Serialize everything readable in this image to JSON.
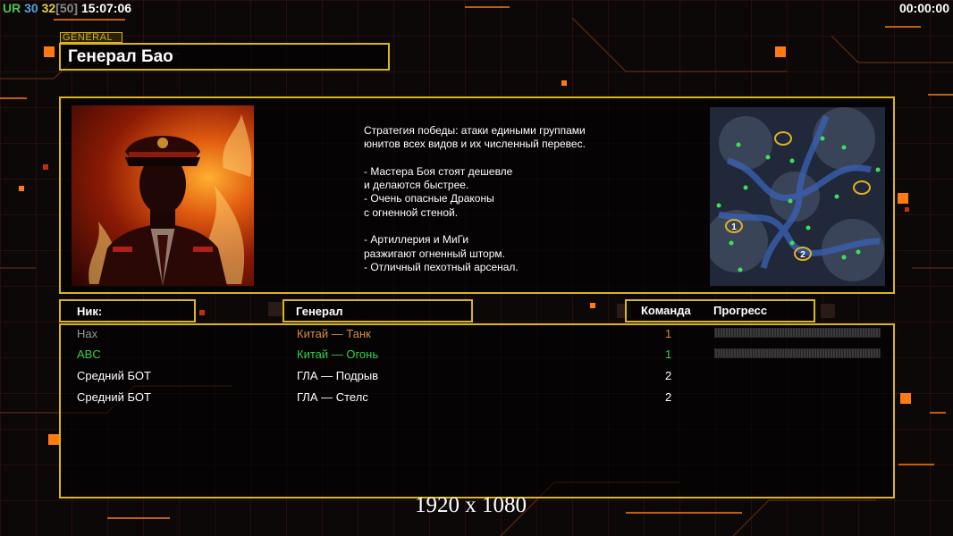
{
  "hud": {
    "ur_label": "UR",
    "count_a": "30",
    "count_b": "32",
    "count_max": "[50]",
    "clock": "15:07:06",
    "timer": "00:00:00"
  },
  "general_tag": "GENERAL",
  "title": "Генерал Бао",
  "description": "Стратегия победы: атаки едиными группами\nюнитов всех видов и их численный перевес.\n\n- Мастера Боя стоят дешевле\nи делаются быстрее.\n- Очень опасные Драконы\nс огненной стеной.\n\n- Артиллерия и МиГи\nразжигают огненный шторм.\n- Отличный пехотный арсенал.",
  "map": {
    "start_markers": [
      "1",
      "2"
    ]
  },
  "table": {
    "headers": {
      "nick": "Ник:",
      "general": "Генерал",
      "team": "Команда",
      "progress": "Прогресс"
    },
    "rows": [
      {
        "nick": "Hax",
        "general": "Китай — Танк",
        "team": "1",
        "color": "#9a9a9a",
        "general_color": "#d98a3a",
        "progress": 0
      },
      {
        "nick": "ABC",
        "general": "Китай — Огонь",
        "team": "1",
        "color": "#2fd14a",
        "general_color": "#2fd14a",
        "progress": 0
      },
      {
        "nick": "Средний БОТ",
        "general": "ГЛА — Подрыв",
        "team": "2",
        "color": "#ffffff",
        "general_color": "#ffffff"
      },
      {
        "nick": "Средний БОТ",
        "general": "ГЛА — Стелс",
        "team": "2",
        "color": "#ffffff",
        "general_color": "#ffffff"
      }
    ]
  },
  "resolution_label": "1920 x 1080",
  "colors": {
    "frame": "#d9b51e",
    "accent_orange": "#ff7a10"
  }
}
